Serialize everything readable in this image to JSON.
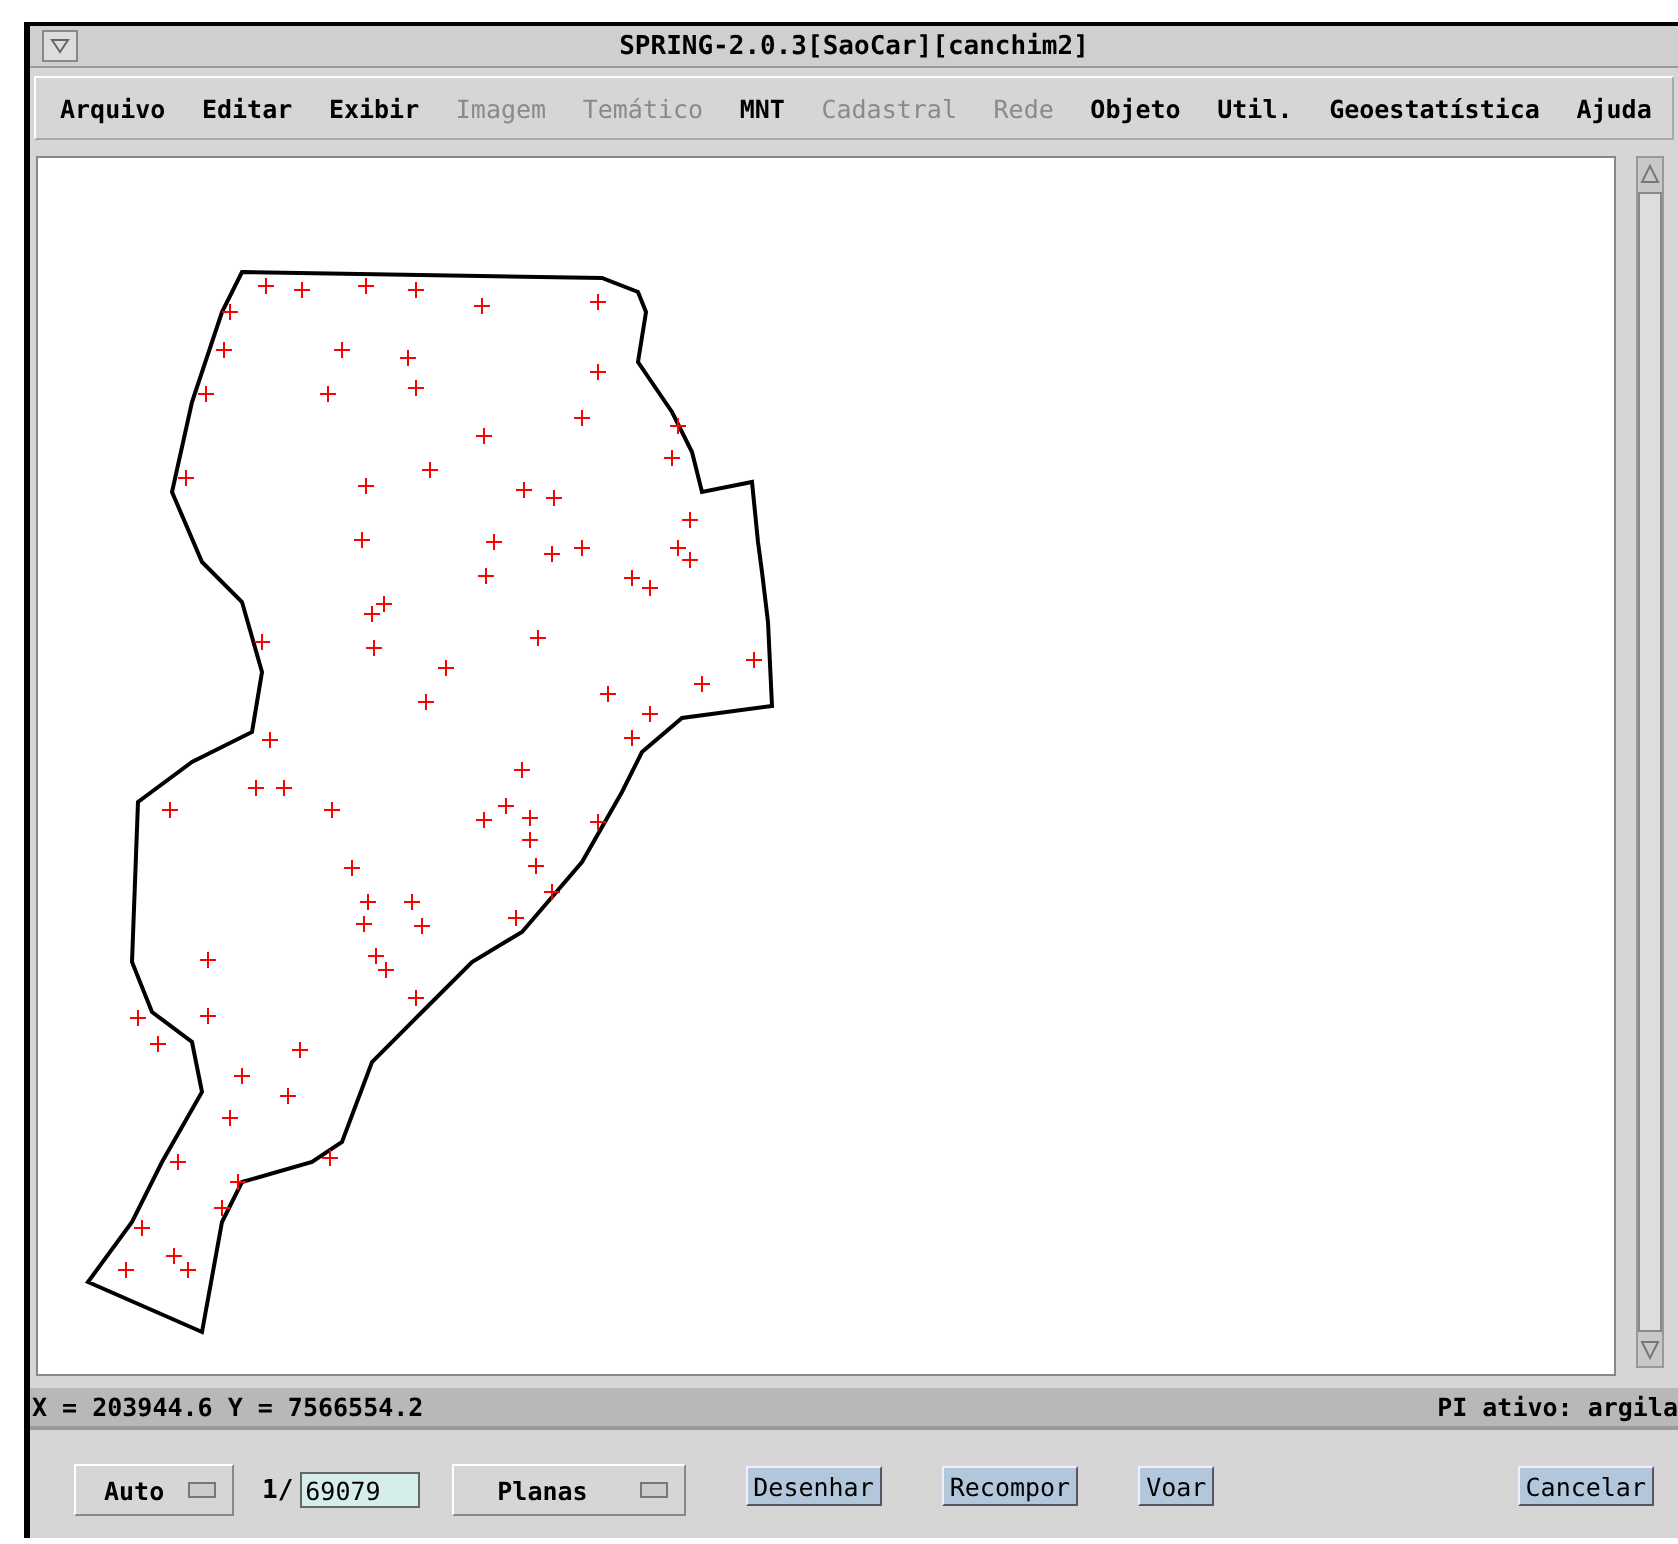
{
  "window": {
    "title": "SPRING-2.0.3[SaoCar][canchim2]"
  },
  "menu": [
    {
      "label": "Arquivo",
      "disabled": false
    },
    {
      "label": "Editar",
      "disabled": false
    },
    {
      "label": "Exibir",
      "disabled": false
    },
    {
      "label": "Imagem",
      "disabled": true
    },
    {
      "label": "Temático",
      "disabled": true
    },
    {
      "label": "MNT",
      "disabled": false
    },
    {
      "label": "Cadastral",
      "disabled": true
    },
    {
      "label": "Rede",
      "disabled": true
    },
    {
      "label": "Objeto",
      "disabled": false
    },
    {
      "label": "Util.",
      "disabled": false
    },
    {
      "label": "Geoestatística",
      "disabled": false
    },
    {
      "label": "Ajuda",
      "disabled": false
    }
  ],
  "status_bar": {
    "coordinates": "X = 203944.6 Y = 7566554.2",
    "active_plane": "PI ativo: argila"
  },
  "controls": {
    "mode": "Auto",
    "scale_prefix": "1/",
    "scale": "69079",
    "projection": "Planas",
    "buttons": [
      "Desenhar",
      "Recompor",
      "Voar",
      "Cancelar"
    ]
  }
}
